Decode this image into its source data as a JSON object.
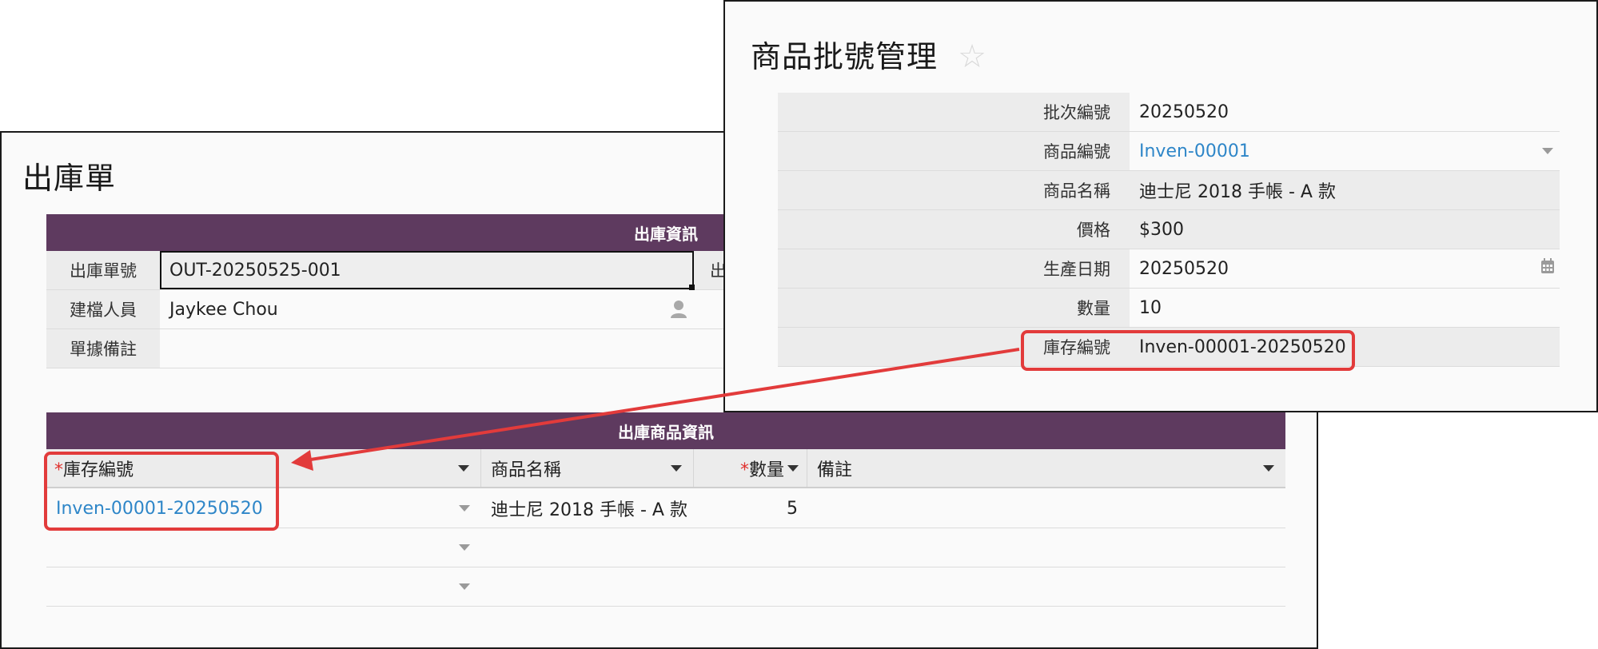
{
  "outbound": {
    "title": "出庫單",
    "section1_title": "出庫資訊",
    "fields": [
      {
        "label": "出庫單號",
        "value": "OUT-20250525-001"
      },
      {
        "label": "建檔人員",
        "value": "Jaykee Chou"
      },
      {
        "label": "單據備註",
        "value": ""
      }
    ],
    "hidden_label_fragment": "出",
    "section2_title": "出庫商品資訊",
    "table": {
      "columns": [
        {
          "label": "庫存編號",
          "required": true
        },
        {
          "label": "商品名稱",
          "required": false
        },
        {
          "label": "數量",
          "required": true
        },
        {
          "label": "備註",
          "required": false
        }
      ],
      "required_mark": "*",
      "rows": [
        {
          "inventory_no": "Inven-00001-20250520",
          "product_name": "迪士尼 2018 手帳 - A 款",
          "qty": "5",
          "note": ""
        },
        {
          "inventory_no": "",
          "product_name": "",
          "qty": "",
          "note": ""
        },
        {
          "inventory_no": "",
          "product_name": "",
          "qty": "",
          "note": ""
        }
      ]
    }
  },
  "batch": {
    "title": "商品批號管理",
    "star_icon": "☆",
    "fields": [
      {
        "label": "批次編號",
        "value": "20250520"
      },
      {
        "label": "商品編號",
        "value": "Inven-00001"
      },
      {
        "label": "商品名稱",
        "value": "迪士尼 2018 手帳 - A 款"
      },
      {
        "label": "價格",
        "value": "$300"
      },
      {
        "label": "生產日期",
        "value": "20250520"
      },
      {
        "label": "數量",
        "value": "10"
      },
      {
        "label": "庫存編號",
        "value": "Inven-00001-20250520"
      }
    ]
  },
  "colors": {
    "header_bg": "#5e3a5f",
    "link": "#2e86c8",
    "highlight": "#e23b3b",
    "required": "#e0312e"
  }
}
